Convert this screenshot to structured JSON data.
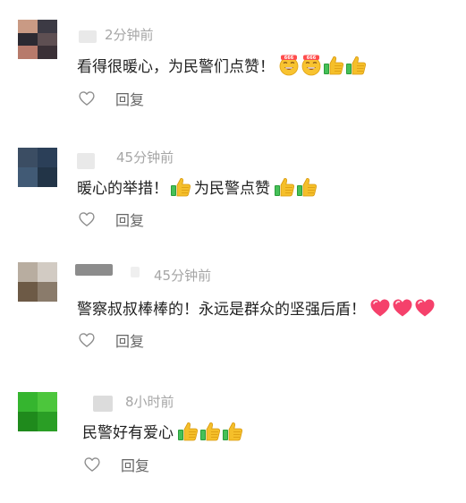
{
  "comments": [
    {
      "avatar_colors": [
        "#c99a84",
        "#3c3a44",
        "#2c2a32",
        "#5e4f52",
        "#b77a6b",
        "#3a3036"
      ],
      "name_redacted": true,
      "time": "2分钟前",
      "text": "看得很暖心，为民警们点赞！",
      "emoji_after": [
        "grin-emoji",
        "grin-emoji",
        "thumbs-up-emoji",
        "thumbs-up-emoji"
      ],
      "like_icon": "heart-outline-icon",
      "reply_label": "回复"
    },
    {
      "avatar_colors": [
        "#3b4d63",
        "#2b3f58",
        "#415a75",
        "#223447"
      ],
      "name_redacted": true,
      "time": "45分钟前",
      "text_before": "暖心的举措！",
      "emoji_middle": [
        "thumbs-up-emoji"
      ],
      "text_after": "为民警点赞",
      "emoji_after": [
        "thumbs-up-emoji",
        "thumbs-up-emoji"
      ],
      "like_icon": "heart-outline-icon",
      "reply_label": "回复"
    },
    {
      "avatar_colors": [
        "#b8ada0",
        "#d2cbc3",
        "#6d5a46",
        "#8a7b6b"
      ],
      "name_redacted": true,
      "time": "45分钟前",
      "text": "警察叔叔棒棒的！永远是群众的坚强后盾！",
      "emoji_after": [
        "heart-emoji",
        "heart-emoji",
        "heart-emoji"
      ],
      "like_icon": "heart-outline-icon",
      "reply_label": "回复"
    },
    {
      "avatar_colors": [
        "#35b52f",
        "#4cc63c",
        "#1f8a1c",
        "#2a9e25"
      ],
      "name_redacted": true,
      "time": "8小时前",
      "text": "民警好有爱心",
      "emoji_after": [
        "thumbs-up-emoji",
        "thumbs-up-emoji",
        "thumbs-up-emoji"
      ],
      "like_icon": "heart-outline-icon",
      "reply_label": "回复"
    }
  ]
}
